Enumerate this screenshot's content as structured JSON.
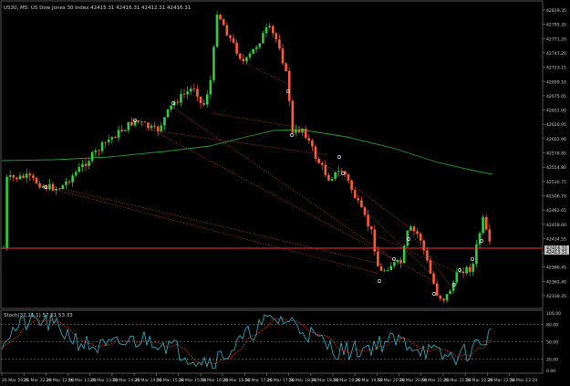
{
  "header": {
    "symbol_label": "US30, M5:  US Dow Jones 30 Index  42415.31 42416.31 42412.31 42416.31"
  },
  "colors": {
    "background": "#000000",
    "bull": "#2ecc40",
    "bear": "#ff5a36",
    "ma_line": "#1f9d2f",
    "price_line": "#ff2b2b",
    "axis_text": "#d0d0d0",
    "stoch_main": "#2fb6c8",
    "stoch_signal": "#ff3b3b",
    "trend_lines": "#c0392b"
  },
  "price_axis": {
    "ticks": [
      "42819.35",
      "42795.35",
      "42771.20",
      "42747.20",
      "42723.15",
      "42699.10",
      "42675.05",
      "42651.00",
      "42626.95",
      "42602.90",
      "42578.85",
      "42554.80",
      "42530.75",
      "42506.70",
      "42482.65",
      "42458.60",
      "42434.55",
      "42410.50",
      "42386.45",
      "42362.40",
      "42338.35"
    ],
    "current_price": "42416.31",
    "current_price_2": "42413.31"
  },
  "stoch": {
    "label": "Stoch(32,11,1) 57.51 53.33",
    "levels": [
      "100.00",
      "80.00",
      "50.00",
      "20.00",
      "0.00"
    ]
  },
  "time_axis": {
    "ticks": [
      "26 Mar 2025",
      "26 Mar 12:20",
      "26 Mar 12:50",
      "26 Mar 13:20",
      "26 Mar 13:50",
      "26 Mar 14:20",
      "26 Mar 14:50",
      "26 Mar 15:20",
      "26 Mar 15:50",
      "26 Mar 16:20",
      "26 Mar 16:50",
      "26 Mar 17:20",
      "26 Mar 17:50",
      "26 Mar 18:20",
      "26 Mar 18:50",
      "26 Mar 19:20",
      "26 Mar 19:50",
      "26 Mar 20:20",
      "26 Mar 20:50",
      "26 Mar 21:20",
      "26 Mar 21:50",
      "26 Mar 22:20",
      "26 Mar 22:50",
      "26 Mar 23:20"
    ]
  }
}
